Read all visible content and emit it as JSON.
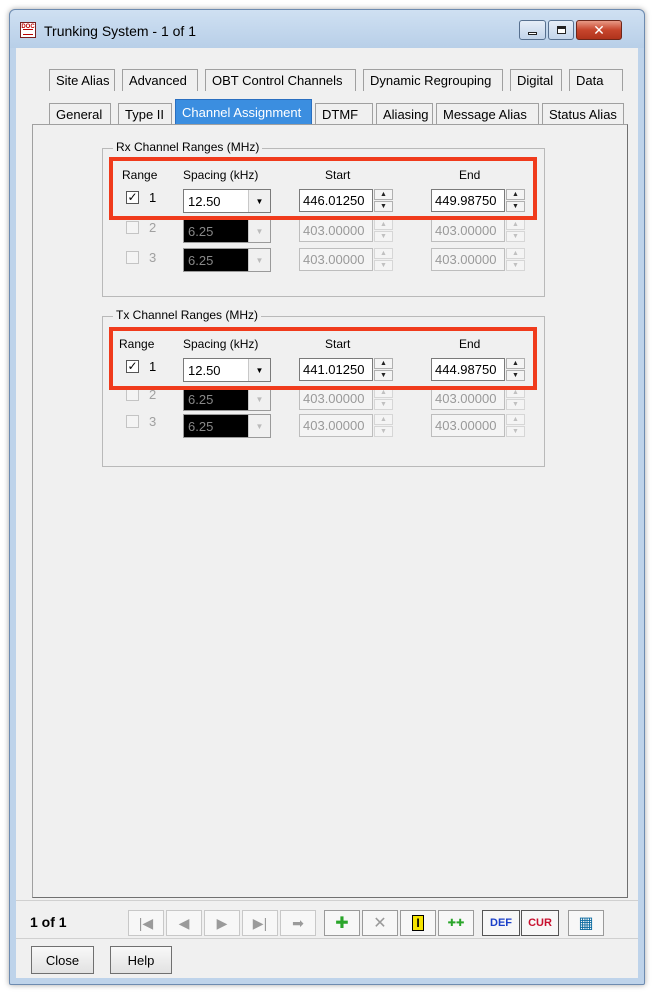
{
  "window": {
    "title": "Trunking System - 1 of 1",
    "close_glyph": "✕"
  },
  "tabs_row1": [
    "Site Alias",
    "Advanced",
    "OBT Control Channels",
    "Dynamic Regrouping",
    "Digital",
    "Data"
  ],
  "tabs_row2": [
    "General",
    "Type II",
    "Channel Assignment",
    "DTMF",
    "Aliasing",
    "Message Alias",
    "Status Alias"
  ],
  "active_tab": "Channel Assignment",
  "rx": {
    "title": "Rx Channel Ranges (MHz)",
    "headers": {
      "range": "Range",
      "spacing": "Spacing (kHz)",
      "start": "Start",
      "end": "End"
    },
    "rows": [
      {
        "num": "1",
        "checked": true,
        "spacing": "12.50",
        "start": "446.01250",
        "end": "449.98750"
      },
      {
        "num": "2",
        "checked": false,
        "spacing": "6.25",
        "start": "403.00000",
        "end": "403.00000"
      },
      {
        "num": "3",
        "checked": false,
        "spacing": "6.25",
        "start": "403.00000",
        "end": "403.00000"
      }
    ]
  },
  "tx": {
    "title": "Tx Channel Ranges (MHz)",
    "headers": {
      "range": "Range",
      "spacing": "Spacing (kHz)",
      "start": "Start",
      "end": "End"
    },
    "rows": [
      {
        "num": "1",
        "checked": true,
        "spacing": "12.50",
        "start": "441.01250",
        "end": "444.98750"
      },
      {
        "num": "2",
        "checked": false,
        "spacing": "6.25",
        "start": "403.00000",
        "end": "403.00000"
      },
      {
        "num": "3",
        "checked": false,
        "spacing": "6.25",
        "start": "403.00000",
        "end": "403.00000"
      }
    ]
  },
  "navigation": {
    "record_count": "1 of 1",
    "first_glyph": "|◀",
    "prev_glyph": "◀",
    "next_glyph": "▶",
    "last_glyph": "▶|",
    "goto_glyph": "➡"
  },
  "toolbar": {
    "add_glyph": "✚",
    "delete_glyph": "✕",
    "insert_glyph": "I",
    "copy_glyph": "✚✚",
    "def_label": "DEF",
    "cur_label": "CUR",
    "grid_glyph": "▦"
  },
  "buttons": {
    "close": "Close",
    "help": "Help"
  },
  "colors": {
    "highlight": "#f03b1c",
    "active_tab": "#3b8ee0",
    "add": "#2aa52a",
    "def": "#1a3fc8",
    "cur": "#c8102e"
  }
}
